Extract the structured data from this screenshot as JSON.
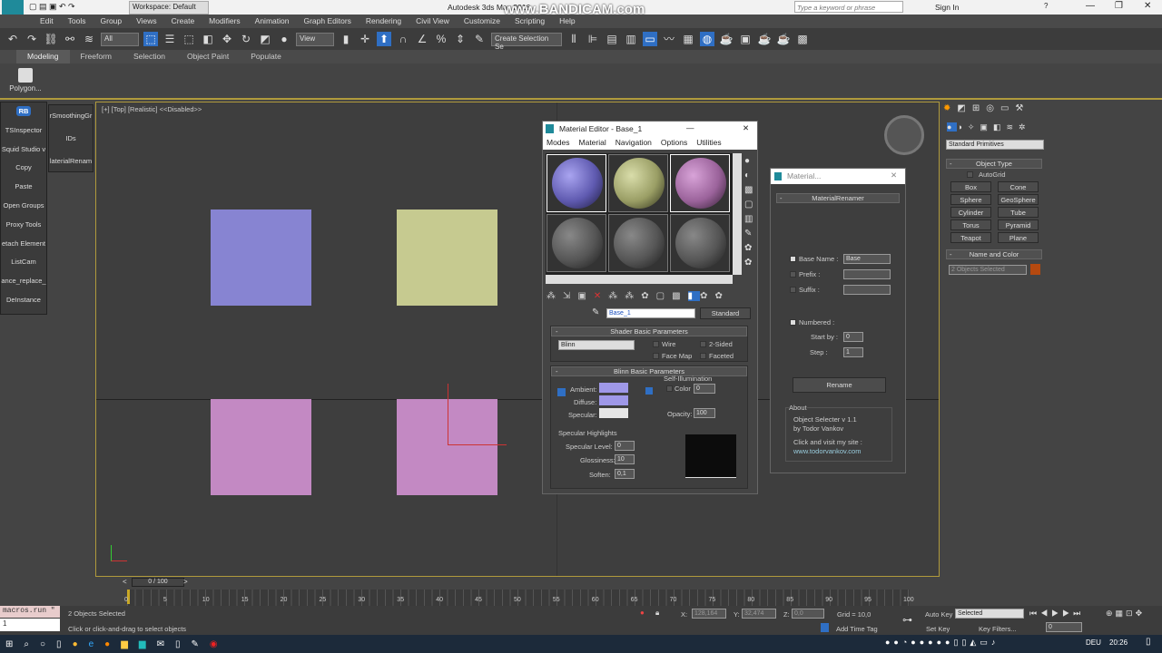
{
  "app": {
    "title": "Autodesk 3ds Max 2016",
    "workspace": "Workspace: Default",
    "watermark": "www.BANDICAM.com",
    "search_placeholder": "Type a keyword or phrase",
    "sign_in": "Sign In",
    "logo": "MAX"
  },
  "menu": [
    "Edit",
    "Tools",
    "Group",
    "Views",
    "Create",
    "Modifiers",
    "Animation",
    "Graph Editors",
    "Rendering",
    "Civil View",
    "Customize",
    "Scripting",
    "Help"
  ],
  "toolbar": {
    "filter": "All",
    "ref_coord": "View",
    "selection_set": "Create Selection Se"
  },
  "ribbon": {
    "tabs": [
      "Modeling",
      "Freeform",
      "Selection",
      "Object Paint",
      "Populate"
    ],
    "polygon_button": "Polygon..."
  },
  "left_panel": {
    "items": [
      "RB",
      "TSInspector",
      "Squid Studio v",
      "Copy",
      "Paste",
      "Open Groups",
      "Proxy Tools",
      "etach Element",
      "ListCam",
      "ance_replace_",
      "DeInstance"
    ],
    "col2": [
      "rSmoothingGr",
      "IDs",
      "laterialRenam"
    ]
  },
  "viewport": {
    "label": "[+] [Top] [Realistic] <<Disabled>>",
    "colors": {
      "square1": "#8784d2",
      "square2": "#c6ca90",
      "square3": "#c389c3",
      "square4": "#c389c3"
    }
  },
  "material_editor": {
    "title": "Material Editor - Base_1",
    "menu": [
      "Modes",
      "Material",
      "Navigation",
      "Options",
      "Utilities"
    ],
    "material_name": "Base_1",
    "material_type": "Standard",
    "shader": {
      "header": "Shader Basic Parameters",
      "shader": "Blinn",
      "wire": "Wire",
      "two_sided": "2-Sided",
      "face_map": "Face Map",
      "faceted": "Faceted"
    },
    "blinn": {
      "header": "Blinn Basic Parameters",
      "self_illum": "Self-Illumination",
      "color_label": "Color",
      "color_value": "0",
      "ambient": "Ambient:",
      "diffuse": "Diffuse:",
      "specular": "Specular:",
      "opacity_label": "Opacity:",
      "opacity": "100",
      "highlights": "Specular Highlights",
      "spec_level_label": "Specular Level:",
      "spec_level": "0",
      "gloss_label": "Glossiness:",
      "gloss": "10",
      "soften_label": "Soften:",
      "soften": "0,1"
    },
    "colors": {
      "ambient": "#9f98e8",
      "specular": "#e6e6e6"
    }
  },
  "renamer": {
    "title": "Material...",
    "header": "MaterialRenamer",
    "base_name_label": "Base Name :",
    "base_name": "Base",
    "prefix_label": "Prefix :",
    "suffix_label": "Suffix :",
    "numbered_label": "Numbered :",
    "start_label": "Start by :",
    "start": "0",
    "step_label": "Step :",
    "step": "1",
    "rename": "Rename",
    "about": "About",
    "about_line1": "Object Selecter v 1.1",
    "about_line2": "by Todor Vankov",
    "about_line3": "Click and visit my site :",
    "about_link": "www.todorvankov.com"
  },
  "command_panel": {
    "category": "Standard Primitives",
    "object_type": "Object Type",
    "autogrid": "AutoGrid",
    "buttons": [
      "Box",
      "Cone",
      "Sphere",
      "GeoSphere",
      "Cylinder",
      "Tube",
      "Torus",
      "Pyramid",
      "Teapot",
      "Plane"
    ],
    "name_color": "Name and Color",
    "name_value": "2 Objects Selected",
    "color": "#b5490f"
  },
  "timeline": {
    "frame": "0 / 100",
    "ticks": [
      "0",
      "5",
      "10",
      "15",
      "20",
      "25",
      "30",
      "35",
      "40",
      "45",
      "50",
      "55",
      "60",
      "65",
      "70",
      "75",
      "80",
      "85",
      "90",
      "95",
      "100"
    ]
  },
  "status": {
    "maxscript": "macros.run \"",
    "maxscript2": "1",
    "selected": "2 Objects Selected",
    "prompt": "Click or click-and-drag to select objects",
    "x": "128,164",
    "y": "32,474",
    "z": "0,0",
    "grid": "Grid = 10,0",
    "add_time_tag": "Add Time Tag",
    "auto_key": "Auto Key",
    "set_key": "Set Key",
    "key_mode": "Selected",
    "key_filters": "Key Filters...",
    "frame_field": "0"
  },
  "taskbar": {
    "lang": "DEU",
    "time": "20:26"
  }
}
